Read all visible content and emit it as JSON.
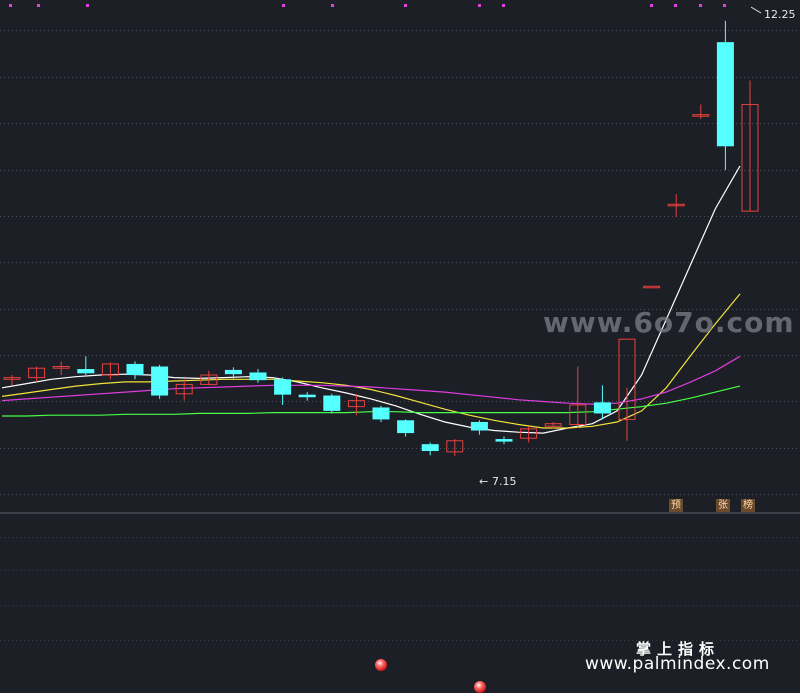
{
  "chart_data": {
    "type": "candlestick",
    "price_ylim": [
      6.8,
      12.4
    ],
    "annotations": {
      "high_label": "12.25",
      "low_label": "7.15",
      "low_arrow": "←"
    },
    "candles": [
      {
        "o": 8.05,
        "h": 8.1,
        "l": 7.98,
        "c": 8.07
      },
      {
        "o": 8.07,
        "h": 8.2,
        "l": 8.02,
        "c": 8.18
      },
      {
        "o": 8.18,
        "h": 8.26,
        "l": 8.1,
        "c": 8.2
      },
      {
        "o": 8.17,
        "h": 8.32,
        "l": 8.1,
        "c": 8.12
      },
      {
        "o": 8.1,
        "h": 8.25,
        "l": 8.05,
        "c": 8.23
      },
      {
        "o": 8.23,
        "h": 8.26,
        "l": 8.05,
        "c": 8.1
      },
      {
        "o": 8.2,
        "h": 8.22,
        "l": 7.82,
        "c": 7.86
      },
      {
        "o": 7.88,
        "h": 8.05,
        "l": 7.8,
        "c": 7.99
      },
      {
        "o": 7.99,
        "h": 8.15,
        "l": 7.98,
        "c": 8.1
      },
      {
        "o": 8.16,
        "h": 8.19,
        "l": 8.06,
        "c": 8.11
      },
      {
        "o": 8.13,
        "h": 8.17,
        "l": 8.01,
        "c": 8.04
      },
      {
        "o": 8.05,
        "h": 8.07,
        "l": 7.75,
        "c": 7.87
      },
      {
        "o": 7.87,
        "h": 7.9,
        "l": 7.8,
        "c": 7.84
      },
      {
        "o": 7.86,
        "h": 7.88,
        "l": 7.65,
        "c": 7.68
      },
      {
        "o": 7.73,
        "h": 7.88,
        "l": 7.63,
        "c": 7.8
      },
      {
        "o": 7.72,
        "h": 7.74,
        "l": 7.55,
        "c": 7.58
      },
      {
        "o": 7.57,
        "h": 7.58,
        "l": 7.38,
        "c": 7.42
      },
      {
        "o": 7.29,
        "h": 7.31,
        "l": 7.16,
        "c": 7.21
      },
      {
        "o": 7.2,
        "h": 7.35,
        "l": 7.15,
        "c": 7.33
      },
      {
        "o": 7.55,
        "h": 7.57,
        "l": 7.4,
        "c": 7.45
      },
      {
        "o": 7.35,
        "h": 7.38,
        "l": 7.29,
        "c": 7.32
      },
      {
        "o": 7.36,
        "h": 7.5,
        "l": 7.31,
        "c": 7.47
      },
      {
        "o": 7.5,
        "h": 7.55,
        "l": 7.47,
        "c": 7.53
      },
      {
        "o": 7.52,
        "h": 8.2,
        "l": 7.48,
        "c": 7.75
      },
      {
        "o": 7.78,
        "h": 7.98,
        "l": 7.58,
        "c": 7.65
      },
      {
        "o": 7.58,
        "h": 7.95,
        "l": 7.33,
        "c": 8.52
      },
      {
        "o": 9.14,
        "h": 9.14,
        "l": 9.14,
        "c": 9.14
      },
      {
        "o": 10.1,
        "h": 10.22,
        "l": 9.95,
        "c": 10.1
      },
      {
        "o": 11.15,
        "h": 11.27,
        "l": 11.1,
        "c": 11.15
      },
      {
        "o": 12.0,
        "h": 12.25,
        "l": 10.5,
        "c": 10.78
      },
      {
        "o": 10.02,
        "h": 11.55,
        "l": 10.02,
        "c": 11.27
      }
    ],
    "ma_series": [
      {
        "color": "#ffffff",
        "values": [
          7.95,
          8.0,
          8.05,
          8.08,
          8.1,
          8.11,
          8.1,
          8.07,
          8.06,
          8.07,
          8.08,
          8.07,
          8.02,
          7.95,
          7.89,
          7.82,
          7.74,
          7.64,
          7.55,
          7.49,
          7.45,
          7.43,
          7.42,
          7.48,
          7.53,
          7.68,
          8.1,
          8.75,
          9.4,
          10.05,
          10.55
        ]
      },
      {
        "color": "#f2e23a",
        "values": [
          7.85,
          7.89,
          7.93,
          7.97,
          8.0,
          8.02,
          8.02,
          8.03,
          8.04,
          8.05,
          8.05,
          8.05,
          8.03,
          8.01,
          7.98,
          7.93,
          7.86,
          7.78,
          7.7,
          7.63,
          7.57,
          7.52,
          7.48,
          7.48,
          7.5,
          7.55,
          7.68,
          7.95,
          8.33,
          8.7,
          9.05
        ]
      },
      {
        "color": "#e03de0",
        "values": [
          7.8,
          7.82,
          7.84,
          7.86,
          7.88,
          7.9,
          7.92,
          7.94,
          7.95,
          7.96,
          7.97,
          7.98,
          7.98,
          7.98,
          7.97,
          7.96,
          7.94,
          7.92,
          7.9,
          7.87,
          7.84,
          7.81,
          7.79,
          7.77,
          7.76,
          7.77,
          7.82,
          7.9,
          8.02,
          8.15,
          8.32
        ]
      },
      {
        "color": "#46ff46",
        "values": [
          7.62,
          7.62,
          7.63,
          7.63,
          7.63,
          7.64,
          7.64,
          7.64,
          7.65,
          7.65,
          7.65,
          7.66,
          7.66,
          7.66,
          7.66,
          7.67,
          7.67,
          7.66,
          7.66,
          7.66,
          7.66,
          7.66,
          7.66,
          7.66,
          7.67,
          7.7,
          7.73,
          7.77,
          7.83,
          7.9,
          7.97
        ]
      }
    ],
    "signal_tags": [
      "预",
      "张",
      "榜"
    ]
  },
  "colors": {
    "background": "#1c1f26",
    "grid": "#4a4f5a",
    "up": "#e8403c",
    "down": "#54ffff",
    "top_dot": "#e040e0",
    "label": "#e8e8e8"
  },
  "watermark": "www.6o7o.com",
  "brand": {
    "name_cn": "掌上指标",
    "url": "www.palmindex.com"
  }
}
